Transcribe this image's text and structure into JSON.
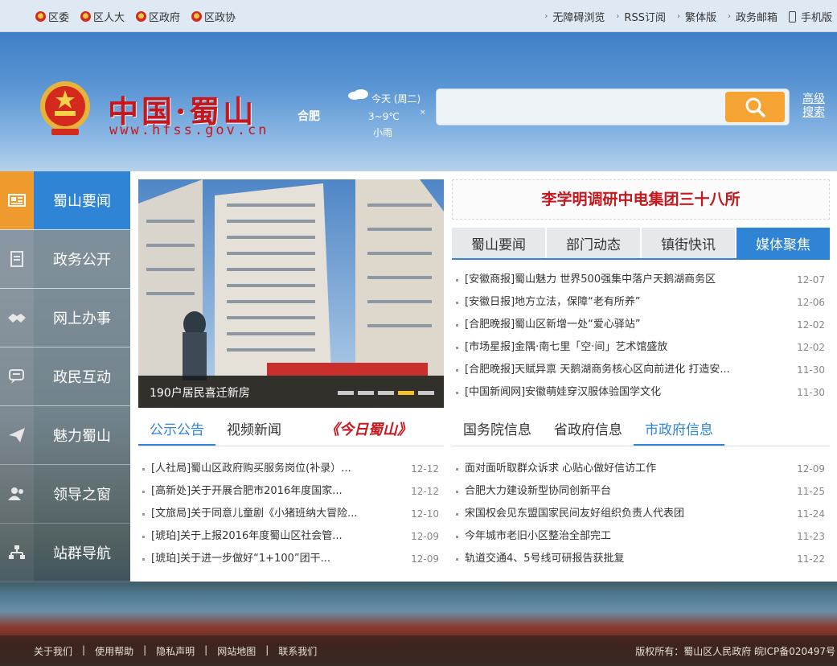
{
  "topbar": {
    "left": [
      "区委",
      "区人大",
      "区政府",
      "区政协"
    ],
    "right": [
      "无障碍浏览",
      "RSS订阅",
      "繁体版",
      "政务邮箱",
      "手机版"
    ]
  },
  "header": {
    "logo_text": "中国·蜀山",
    "logo_url": "www.hfss.gov.cn",
    "city": "合肥",
    "weather": {
      "day": "今天 (周二)",
      "temp": "3~9℃",
      "desc": "小雨"
    },
    "search_placeholder": "",
    "advanced_search": "高级搜索"
  },
  "nav": [
    {
      "label": "蜀山要闻",
      "icon": "newspaper-icon",
      "active": true
    },
    {
      "label": "政务公开",
      "icon": "document-icon",
      "active": false
    },
    {
      "label": "网上办事",
      "icon": "handshake-icon",
      "active": false
    },
    {
      "label": "政民互动",
      "icon": "chat-icon",
      "active": false
    },
    {
      "label": "魅力蜀山",
      "icon": "paper-plane-icon",
      "active": false
    },
    {
      "label": "领导之窗",
      "icon": "users-icon",
      "active": false
    },
    {
      "label": "站群导航",
      "icon": "sitemap-icon",
      "active": false
    }
  ],
  "slide": {
    "caption": "190户居民喜迁新房",
    "active_dot": 3
  },
  "headline": "李学明调研中电集团三十八所",
  "news_tabs": [
    "蜀山要闻",
    "部门动态",
    "镇街快讯",
    "媒体聚焦"
  ],
  "news_tabs_active": 3,
  "news": [
    {
      "text": "[安徽商报]蜀山魅力 世界500强集中落户天鹅湖商务区",
      "date": "12-07"
    },
    {
      "text": "[安徽日报]地方立法，保障“老有所养”",
      "date": "12-06"
    },
    {
      "text": "[合肥晚报]蜀山区新增一处“爱心驿站”",
      "date": "12-02"
    },
    {
      "text": "[市场星报]金隅·南七里「空·间」艺术馆盛放",
      "date": "12-02"
    },
    {
      "text": "[合肥晚报]天赋异禀 天鹅湖商务核心区向前进化 打造安...",
      "date": "11-30"
    },
    {
      "text": "[中国新闻网]安徽萌娃穿汉服体验国学文化",
      "date": "11-30"
    }
  ],
  "notice_tabs": [
    "公示公告",
    "视频新闻"
  ],
  "notice_brand": "《今日蜀山》",
  "notices": [
    {
      "text": "[人社局]蜀山区政府购买服务岗位(补录）...",
      "date": "12-12"
    },
    {
      "text": "[高新处]关于开展合肥市2016年度国家...",
      "date": "12-12"
    },
    {
      "text": "[文旅局]关于同意儿童剧《小猪班纳大冒险...",
      "date": "12-10"
    },
    {
      "text": "[琥珀]关于上报2016年度蜀山区社会管...",
      "date": "12-09"
    },
    {
      "text": "[琥珀]关于进一步做好“1+100”团干...",
      "date": "12-09"
    }
  ],
  "gov_tabs": [
    "国务院信息",
    "省政府信息",
    "市政府信息"
  ],
  "gov_tabs_active": 2,
  "gov_news": [
    {
      "text": "面对面听取群众诉求 心贴心做好信访工作",
      "date": "12-09"
    },
    {
      "text": "合肥大力建设新型协同创新平台",
      "date": "11-25"
    },
    {
      "text": "宋国权会见东盟国家民间友好组织负责人代表团",
      "date": "11-24"
    },
    {
      "text": "今年城市老旧小区整治全部完工",
      "date": "11-23"
    },
    {
      "text": "轨道交通4、5号线可研报告获批复",
      "date": "11-22"
    }
  ],
  "footer": {
    "links": [
      "关于我们",
      "使用帮助",
      "隐私声明",
      "网站地图",
      "联系我们"
    ],
    "copyright": "版权所有：蜀山区人民政府  皖ICP备020497号"
  },
  "colors": {
    "accent_blue": "#2f84d6",
    "accent_orange": "#ee9a2d",
    "brand_red": "#c8161d"
  }
}
